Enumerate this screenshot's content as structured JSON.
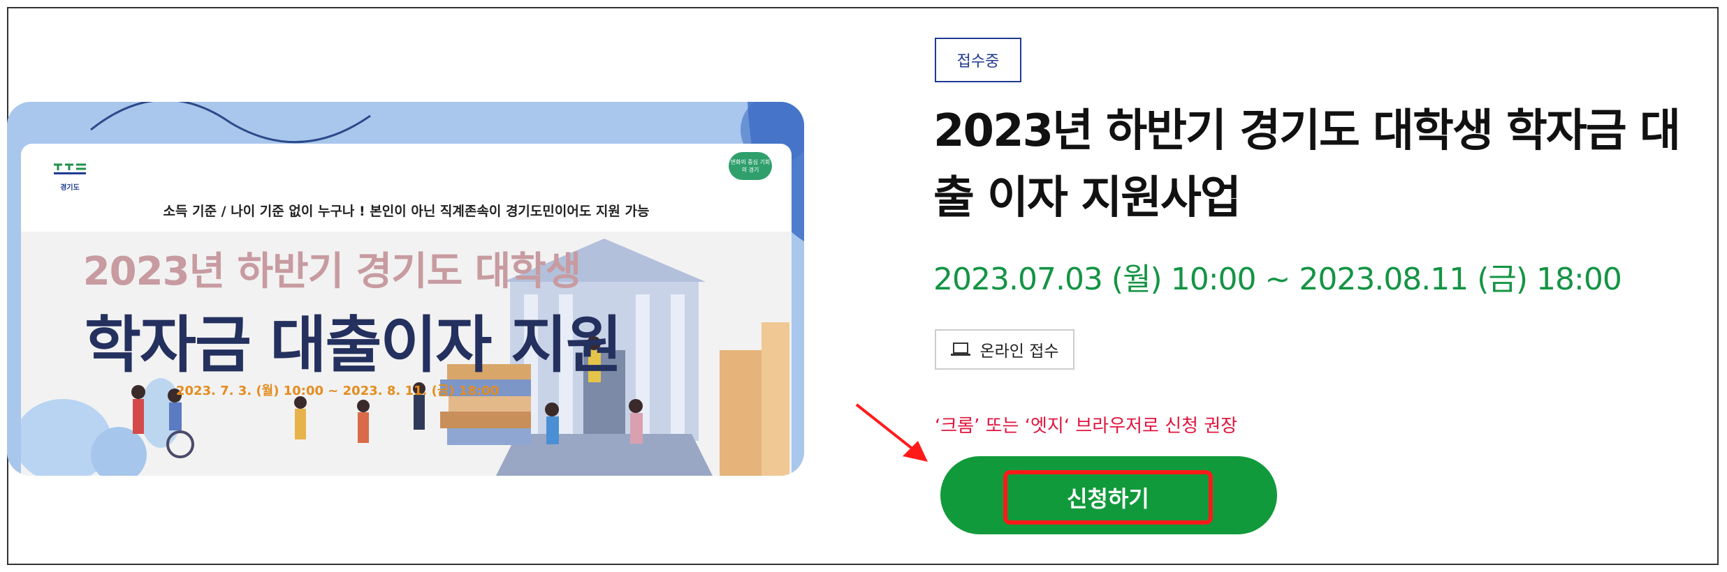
{
  "status_badge": "접수중",
  "title": "2023년 하반기 경기도 대학생 학자금 대출 이자 지원사업",
  "period": "2023.07.03 (월) 10:00 ~ 2023.08.11 (금) 18:00",
  "online_chip": {
    "icon": "laptop-icon",
    "label": "온라인 접수"
  },
  "notice": "‘크롬’ 또는 ‘엣지‘ 브라우저로 신청 권장",
  "apply_button": "신청하기",
  "banner": {
    "logo_text": "경기도",
    "badge_text": "변화의 중심 기회의 경기",
    "subtitle": "소득 기준 / 나이 기준 없이 누구나 !  본인이 아닌 직계존속이 경기도민이어도 지원 가능",
    "title_line1": "2023년 하반기 경기도 대학생",
    "title_line2": "학자금 대출이자 지원",
    "date": "2023. 7. 3. (월) 10:00 ~ 2023. 8. 11. (금) 18:00"
  },
  "colors": {
    "accent_green": "#119a3c",
    "period_green": "#149444",
    "notice_red": "#e0143c",
    "badge_navy": "#1f3a93",
    "highlight_red": "#ff1a1a"
  }
}
